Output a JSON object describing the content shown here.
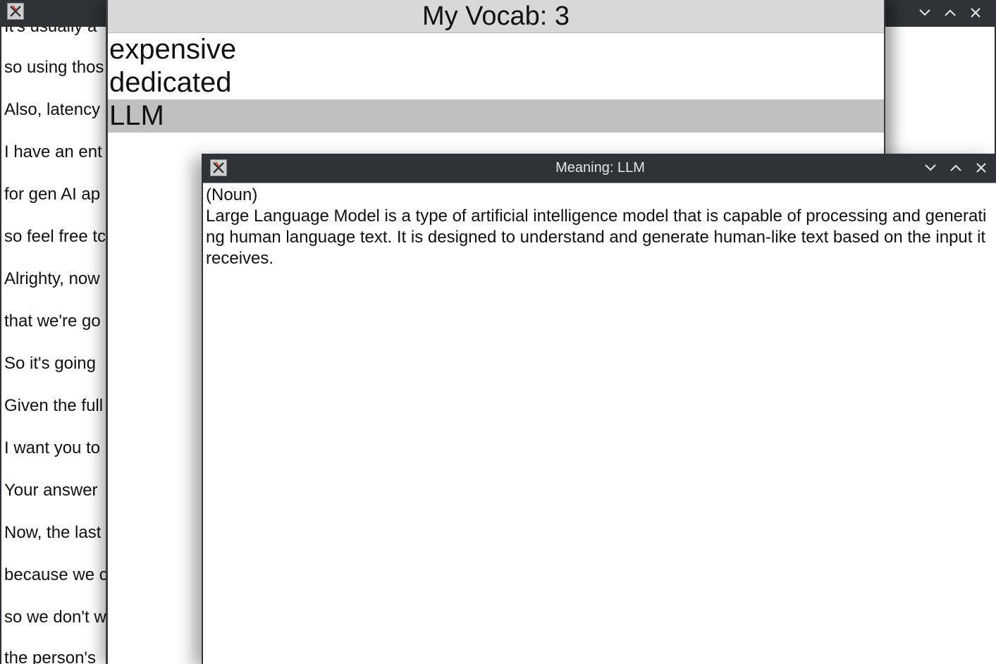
{
  "background_window": {
    "lines": [
      "It's usually a",
      "so using thos",
      "Also, latency",
      "I have an ent",
      "for gen AI ap",
      "so feel free tc",
      "Alrighty, now",
      "that we're go",
      "So it's going",
      "Given the full",
      "I want you to",
      "Your answer",
      "Now, the last",
      "because we c",
      "so we don't w",
      "the person's"
    ]
  },
  "vocab_window": {
    "header": "My Vocab: 3",
    "items": [
      "expensive",
      "dedicated",
      "LLM"
    ],
    "selected_index": 2
  },
  "meaning_window": {
    "title": "Meaning: LLM",
    "part_of_speech": "(Noun)",
    "definition": "Large Language Model is a type of artificial intelligence model that is capable of processing and generating human language text. It is designed to understand and generate human-like text based on the input it receives."
  },
  "icons": {
    "app": "x-app-icon",
    "minimize": "chevron-down-icon",
    "maximize": "chevron-up-icon",
    "close": "close-icon"
  },
  "colors": {
    "titlebar": "#2f3237",
    "vocab_header": "#d8d8d8",
    "selected_item": "#c0c0c0"
  }
}
